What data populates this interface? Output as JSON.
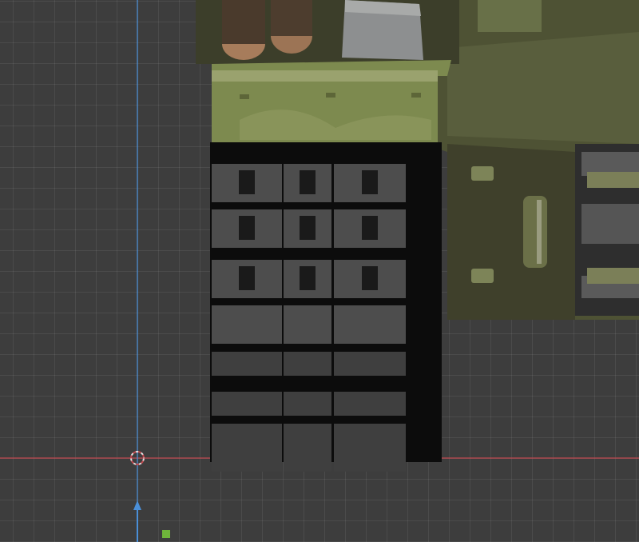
{
  "viewport": {
    "mode": "3d-viewport",
    "colors": {
      "background": "#3d3d3d",
      "x_axis": "#c0484f",
      "y_axis": "#4a8fd8",
      "fender": "#7d8a4f",
      "hull": "#4e5234",
      "track": "#4a4a4a",
      "gizmo_green": "#6fb43b"
    },
    "icons": [
      "3d-cursor-icon",
      "z-axis-arrow-icon",
      "origin-point-icon"
    ]
  }
}
